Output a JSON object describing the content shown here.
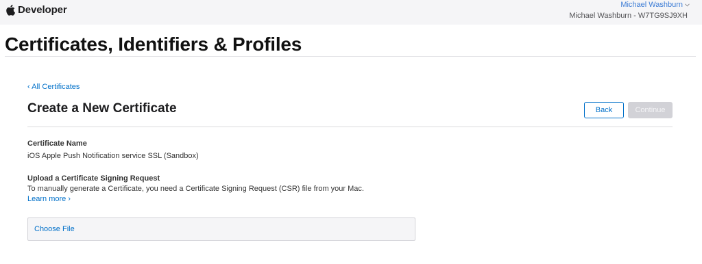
{
  "header": {
    "brand": "Developer",
    "account_name": "Michael Washburn",
    "team": "Michael Washburn - W7TG9SJ9XH"
  },
  "page": {
    "title": "Certificates, Identifiers & Profiles"
  },
  "main": {
    "breadcrumb": "‹ All Certificates",
    "title": "Create a New Certificate",
    "back_label": "Back",
    "continue_label": "Continue",
    "certificate_name_label": "Certificate Name",
    "certificate_name_value": "iOS Apple Push Notification service SSL (Sandbox)",
    "upload_label": "Upload a Certificate Signing Request",
    "upload_description": "To manually generate a Certificate, you need a Certificate Signing Request (CSR) file from your Mac.",
    "learn_more": "Learn more ›",
    "choose_file": "Choose File"
  },
  "colors": {
    "link": "#0070c9",
    "disabled_button": "#d2d2d7",
    "topbar_bg": "#f5f5f7"
  },
  "icons": [
    "apple-logo-icon",
    "chevron-down-icon"
  ]
}
